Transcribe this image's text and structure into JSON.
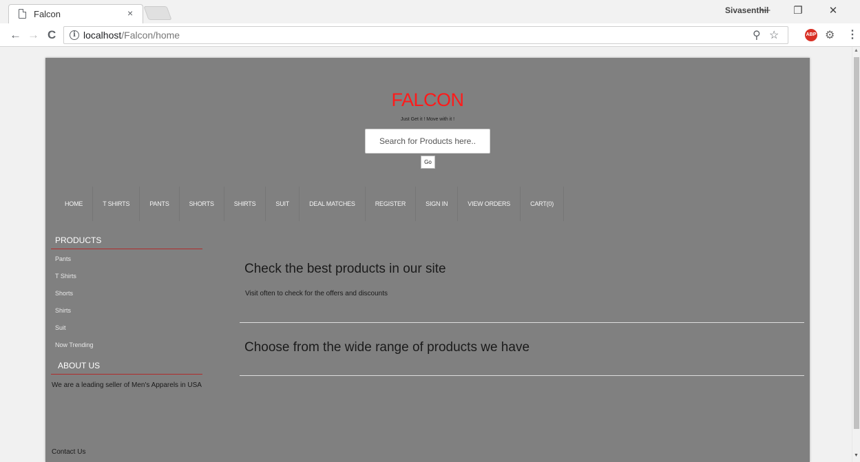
{
  "browser": {
    "tab_title": "Falcon",
    "tab_close": "×",
    "profile_name": "Sivasenthil",
    "url_host": "localhost",
    "url_path": "/Falcon/home",
    "win_minimize": "—",
    "win_restore": "❐",
    "win_close": "✕",
    "back": "←",
    "forward": "→",
    "reload": "C",
    "zoom_icon": "⚲",
    "star_icon": "☆",
    "abp_label": "ABP",
    "menu": "⋮"
  },
  "header": {
    "brand": "FALCON",
    "tagline": "Just Get it ! Move with it !",
    "search_placeholder": "Search for Products here..",
    "go_label": "Go"
  },
  "nav": {
    "items": [
      "HOME",
      "T SHIRTS",
      "PANTS",
      "SHORTS",
      "SHIRTS",
      "SUIT",
      "DEAL MATCHES",
      "REGISTER",
      "SIGN IN",
      "VIEW ORDERS",
      "CART(0)"
    ]
  },
  "sidebar": {
    "products_heading": "PRODUCTS",
    "products": [
      "Pants",
      "T Shirts",
      "Shorts",
      "Shirts",
      "Suit",
      "Now Trending"
    ],
    "about_heading": "ABOUT US",
    "about_text": "We are a leading seller of Men's Apparels in USA",
    "contact": "Contact Us"
  },
  "main": {
    "heading1": "Check the best products in our site",
    "paragraph1": "Visit often to check for the offers and discounts",
    "heading2": "Choose from the wide range of products we have"
  },
  "colors": {
    "brand": "#ff1a1a",
    "page_bg": "#808080",
    "heading_rule": "#b02a2a"
  }
}
